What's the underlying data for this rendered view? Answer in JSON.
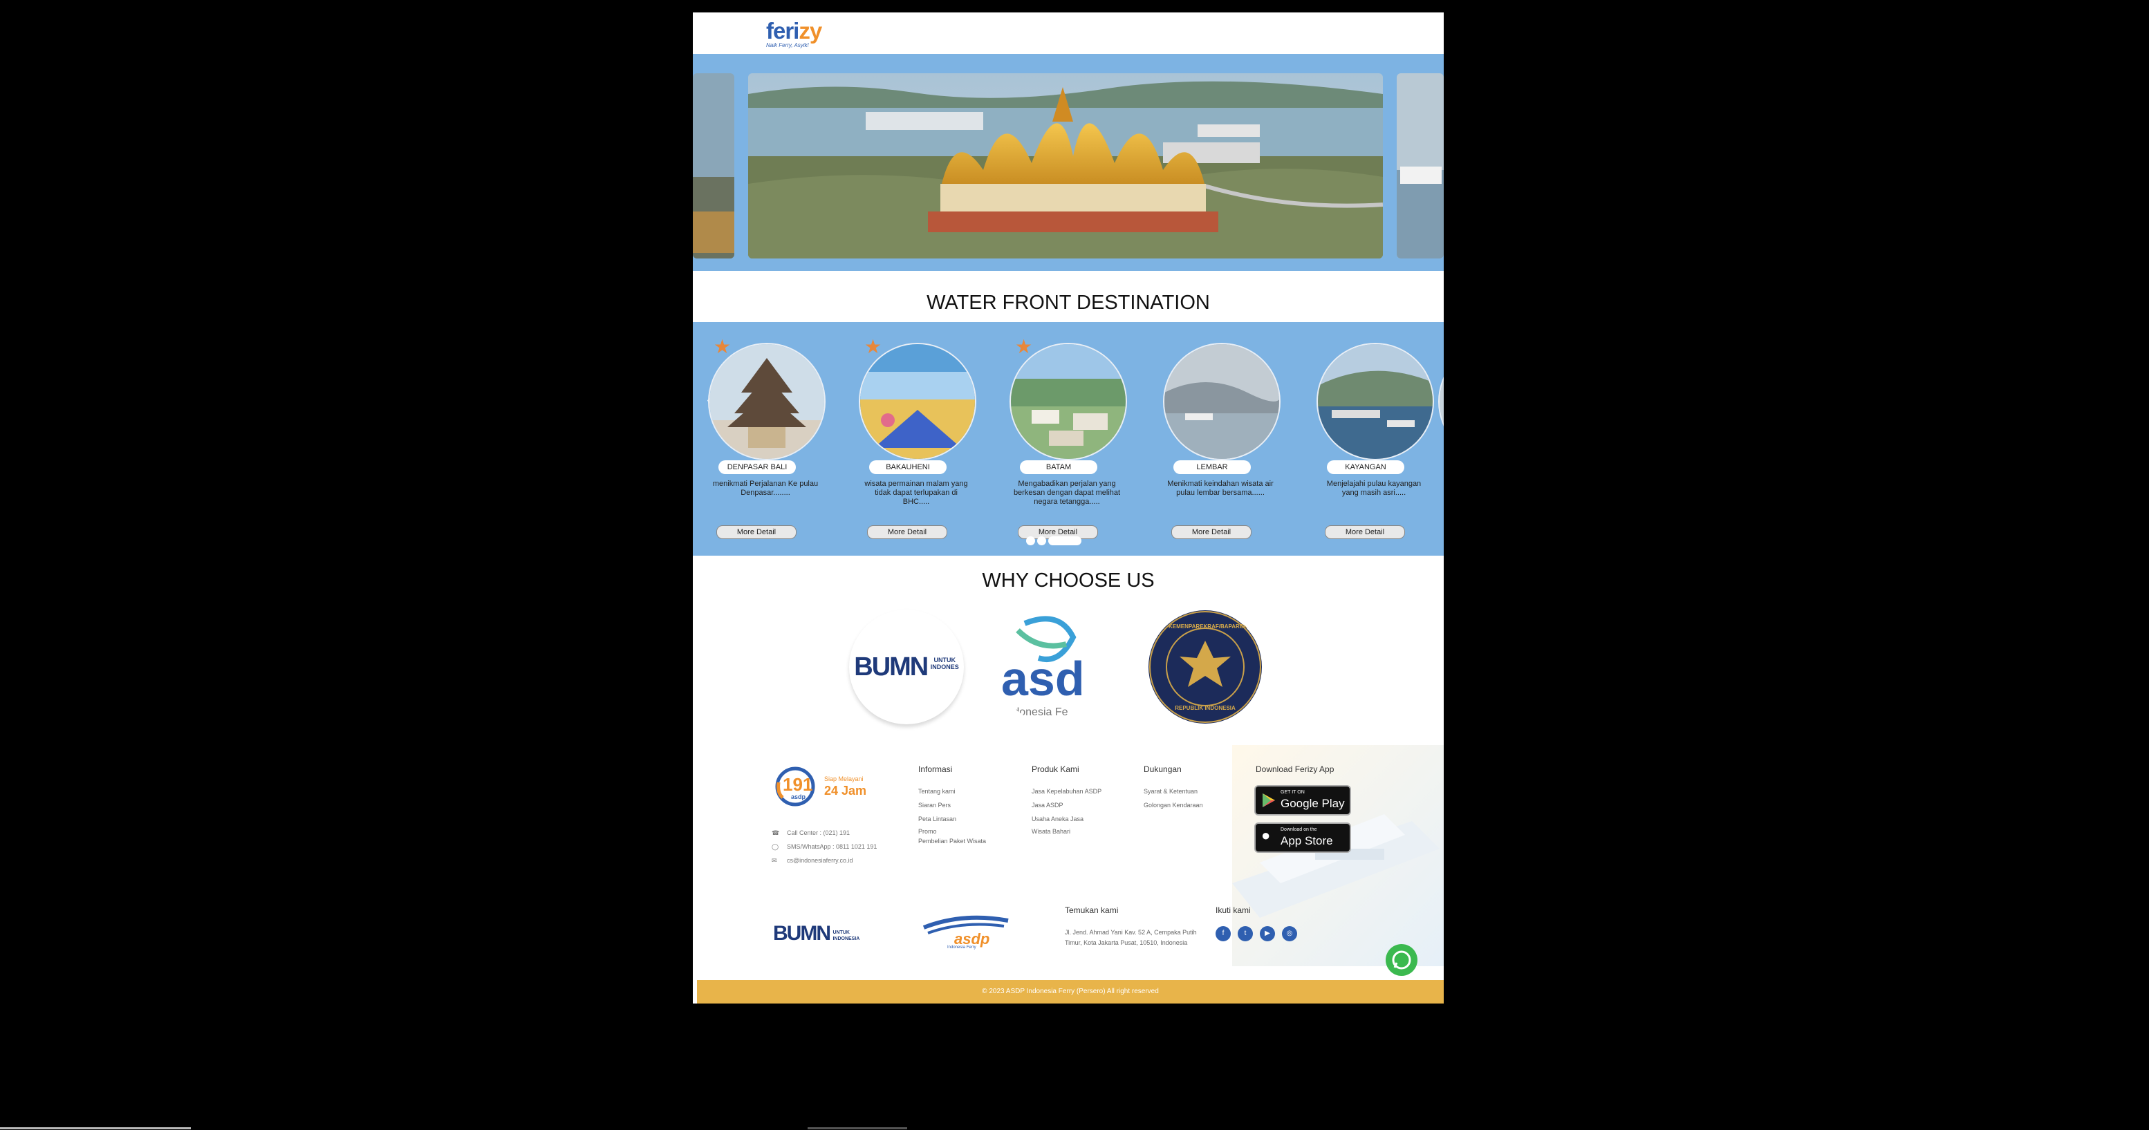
{
  "header": {
    "logo_main_a": "feri",
    "logo_main_b": "zy",
    "logo_tag": "Naik Ferry, Asyik!"
  },
  "sections": {
    "waterfront_title": "WATER FRONT DESTINATION",
    "why_title": "WHY CHOOSE US"
  },
  "destinations": [
    {
      "name": "DENPASAR BALI",
      "desc": "menikmati Perjalanan Ke pulau Denpasar........",
      "button": "More Detail"
    },
    {
      "name": "BAKAUHENI",
      "desc": "wisata permainan malam yang tidak dapat terlupakan di BHC.....",
      "button": "More Detail"
    },
    {
      "name": "BATAM",
      "desc": "Mengabadikan perjalan yang berkesan dengan dapat melihat negara tetangga.....",
      "button": "More Detail"
    },
    {
      "name": "LEMBAR",
      "desc": "Menikmati keindahan wisata air pulau lembar bersama......",
      "button": "More Detail"
    },
    {
      "name": "KAYANGAN",
      "desc": "Menjelajahi pulau kayangan yang masih asri.....",
      "button": "More Detail"
    }
  ],
  "why_logos": {
    "bumn_a": "BUMN",
    "bumn_b": "UNTUK",
    "bumn_c": "INDONES",
    "asdp_a": "asd",
    "asdp_b": "Indonesia Fe",
    "kemenparekraf_ring": "KEMENPAREKRAF/BAPAREKRAF",
    "kemenparekraf_bottom": "REPUBLIK INDONESIA"
  },
  "footer": {
    "callcenter_num": "191",
    "callcenter_brand": "asdp",
    "callcenter_line1": "Siap Melayani",
    "callcenter_line2": "24 Jam",
    "contacts": [
      "Call Center : (021) 191",
      "SMS/WhatsApp : 0811 1021 191",
      "cs@indonesiaferry.co.id"
    ],
    "info": {
      "title": "Informasi",
      "links": [
        "Tentang kami",
        "Siaran Pers",
        "Peta Lintasan",
        "Promo",
        "Pembelian Paket Wisata"
      ]
    },
    "produk": {
      "title": "Produk Kami",
      "links": [
        "Jasa Kepelabuhan ASDP",
        "Jasa ASDP",
        "Usaha Aneka Jasa",
        "Wisata Bahari"
      ]
    },
    "dukungan": {
      "title": "Dukungan",
      "links": [
        "Syarat & Ketentuan",
        "Golongan Kendaraan"
      ]
    },
    "download": {
      "title": "Download Ferizy App",
      "google_small": "GET IT ON",
      "google_large": "Google Play",
      "apple_small": "Download on the",
      "apple_large": "App Store"
    },
    "bumn_logo_a": "BUMN",
    "bumn_logo_b": "UNTUK",
    "bumn_logo_c": "INDONESIA",
    "asdp_logo": "asdp",
    "asdp_logo_sub": "Indonesia Ferry",
    "find_title": "Temukan kami",
    "address": "Jl. Jend. Ahmad Yani Kav. 52 A, Cempaka Putih Timur, Kota Jakarta Pusat, 10510, Indonesia",
    "follow_title": "Ikuti kami",
    "socials": [
      "f",
      "t",
      "▶",
      "◎"
    ],
    "copyright": "© 2023 ASDP Indonesia Ferry (Persero) All right reserved"
  },
  "colors": {
    "hero_bg": "#7db3e3",
    "accent_orange": "#f0902a",
    "brand_blue": "#2f5fb0",
    "footer_bar": "#e8b44a"
  },
  "icons": [
    "phone-icon",
    "whatsapp-icon",
    "mail-icon",
    "chevron-left-icon",
    "chevron-right-icon",
    "star-icon",
    "facebook-icon",
    "twitter-icon",
    "youtube-icon",
    "instagram-icon"
  ]
}
